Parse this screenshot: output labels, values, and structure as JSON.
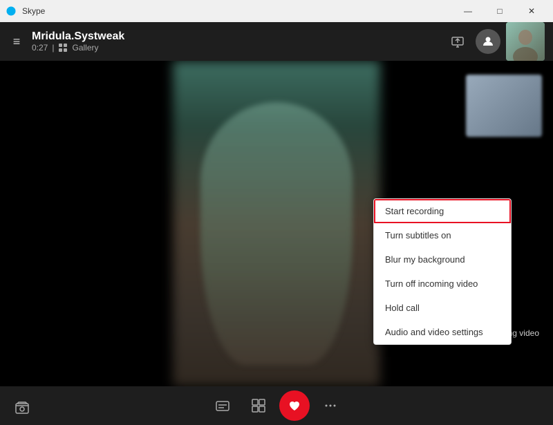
{
  "titleBar": {
    "icon": "skype",
    "title": "Skype",
    "minimize": "—",
    "maximize": "□",
    "close": "✕"
  },
  "header": {
    "hamburger": "≡",
    "name": "Mridula.Systweak",
    "timer": "0:27",
    "separator": "|",
    "gallery": "Gallery"
  },
  "contextMenu": {
    "items": [
      {
        "label": "Start recording",
        "highlighted": true
      },
      {
        "label": "Turn subtitles on",
        "highlighted": false
      },
      {
        "label": "Blur my background",
        "highlighted": false
      },
      {
        "label": "Turn off incoming video",
        "highlighted": false
      },
      {
        "label": "Hold call",
        "highlighted": false
      },
      {
        "label": "Audio and video settings",
        "highlighted": false
      }
    ]
  },
  "bottomBar": {
    "captionsIcon": "💬",
    "switchIcon": "⧉",
    "heartIcon": "♥",
    "moreIcon": "•••"
  },
  "incomingVideo": {
    "label": "incoming video"
  }
}
